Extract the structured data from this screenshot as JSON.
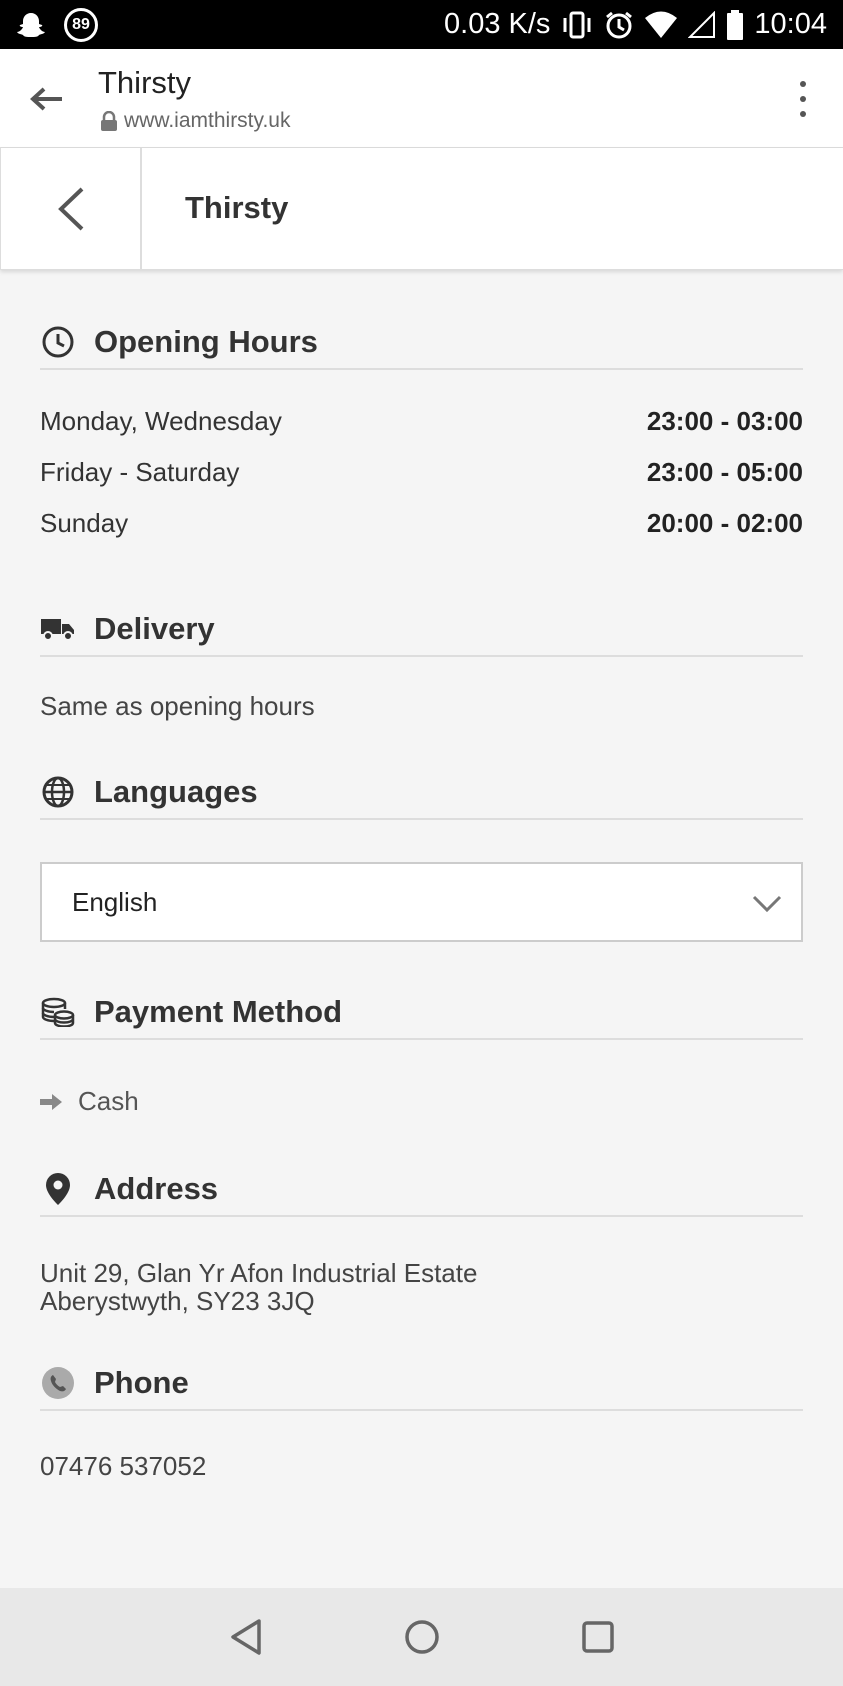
{
  "status_bar": {
    "notification_badge": "89",
    "net_speed": "0.03 K/s",
    "time": "10:04",
    "icons": [
      "snapchat-icon",
      "vibrate-icon",
      "alarm-icon",
      "wifi-icon",
      "signal-icon",
      "battery-icon"
    ]
  },
  "browser": {
    "title": "Thirsty",
    "url": "www.iamthirsty.uk"
  },
  "page": {
    "title": "Thirsty"
  },
  "opening_hours": {
    "heading": "Opening Hours",
    "rows": [
      {
        "days": "Monday, Wednesday",
        "time": "23:00 - 03:00"
      },
      {
        "days": "Friday - Saturday",
        "time": "23:00 - 05:00"
      },
      {
        "days": "Sunday",
        "time": "20:00 - 02:00"
      }
    ]
  },
  "delivery": {
    "heading": "Delivery",
    "text": "Same as opening hours"
  },
  "languages": {
    "heading": "Languages",
    "selected": "English"
  },
  "payment": {
    "heading": "Payment Method",
    "methods": [
      "Cash"
    ]
  },
  "address": {
    "heading": "Address",
    "line1": "Unit 29, Glan Yr Afon Industrial Estate",
    "line2": "Aberystwyth, SY23 3JQ"
  },
  "phone": {
    "heading": "Phone",
    "number": "07476 537052"
  },
  "colors": {
    "status_bar_bg": "#000000",
    "page_bg": "#f5f5f5",
    "nav_bar_bg": "#e8e8e8"
  }
}
